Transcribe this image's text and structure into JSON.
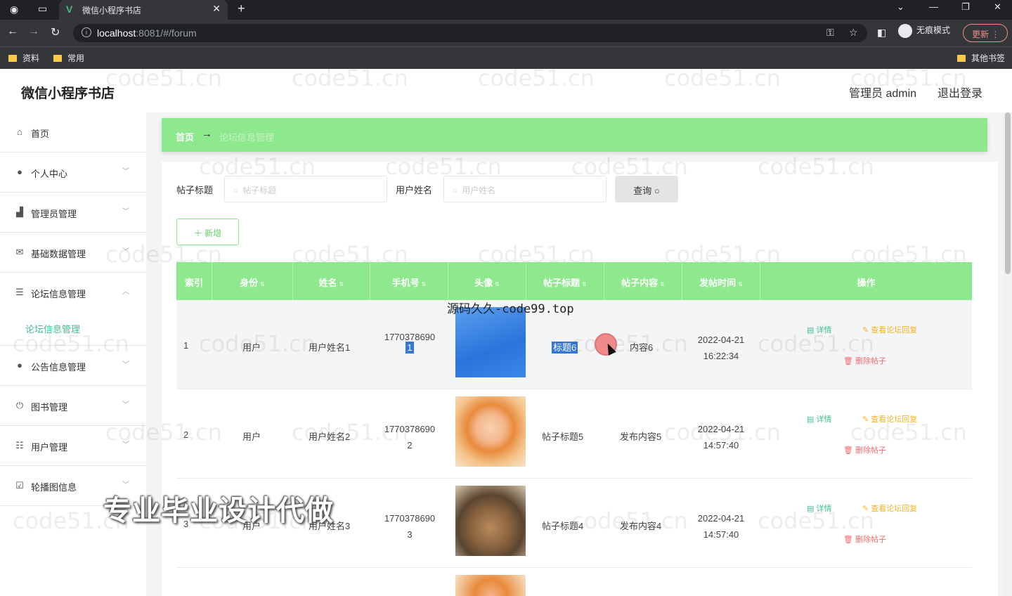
{
  "browser": {
    "tab_title": "微信小程序书店",
    "url_host": "localhost",
    "url_rest": ":8081/#/forum",
    "incognito_label": "无痕模式",
    "update_label": "更新",
    "bookmarks": [
      "资料",
      "常用"
    ],
    "other_bookmarks": "其他书签"
  },
  "header": {
    "brand": "微信小程序书店",
    "admin": "管理员 admin",
    "logout": "退出登录"
  },
  "sidebar": {
    "items": [
      {
        "label": "首页",
        "icon": "home-icon"
      },
      {
        "label": "个人中心",
        "icon": "user-icon"
      },
      {
        "label": "管理员管理",
        "icon": "admin-icon"
      },
      {
        "label": "基础数据管理",
        "icon": "mail-icon"
      },
      {
        "label": "论坛信息管理",
        "icon": "list-icon"
      },
      {
        "label": "公告信息管理",
        "icon": "user-icon"
      },
      {
        "label": "图书管理",
        "icon": "power-icon"
      },
      {
        "label": "用户管理",
        "icon": "sliders-icon"
      },
      {
        "label": "轮播图信息",
        "icon": "chart-icon"
      }
    ],
    "active_sub": "论坛信息管理"
  },
  "breadcrumb": {
    "home": "首页",
    "sep": "→",
    "current": "论坛信息管理"
  },
  "filters": {
    "title_label": "帖子标题",
    "title_placeholder": "帖子标题",
    "user_label": "用户姓名",
    "user_placeholder": "用户姓名",
    "query_label": "查询",
    "add_label": "新增"
  },
  "table": {
    "columns": [
      "索引",
      "身份",
      "姓名",
      "手机号",
      "头像",
      "帖子标题",
      "帖子内容",
      "发帖时间",
      "操作"
    ],
    "rows": [
      {
        "index": "1",
        "role": "用户",
        "name": "用户姓名1",
        "phone_a": "1770378690",
        "phone_b": "1",
        "title": "帖子标题6",
        "title_sel": "标题6",
        "content": "内容6",
        "date": "2022-04-21",
        "time": "16:22:34"
      },
      {
        "index": "2",
        "role": "用户",
        "name": "用户姓名2",
        "phone_a": "1770378690",
        "phone_b": "2",
        "title": "帖子标题5",
        "content": "发布内容5",
        "date": "2022-04-21",
        "time": "14:57:40"
      },
      {
        "index": "3",
        "role": "用户",
        "name": "用户姓名3",
        "phone_a": "1770378690",
        "phone_b": "3",
        "title": "帖子标题4",
        "content": "发布内容4",
        "date": "2022-04-21",
        "time": "14:57:40"
      }
    ],
    "actions": {
      "detail": "详情",
      "view": "查看论坛回复",
      "delete": "删除帖子"
    }
  },
  "overlays": {
    "watermark": "code51.cn",
    "top_text": "源码久久-code99.top",
    "big_text": "专业毕业设计代做"
  }
}
